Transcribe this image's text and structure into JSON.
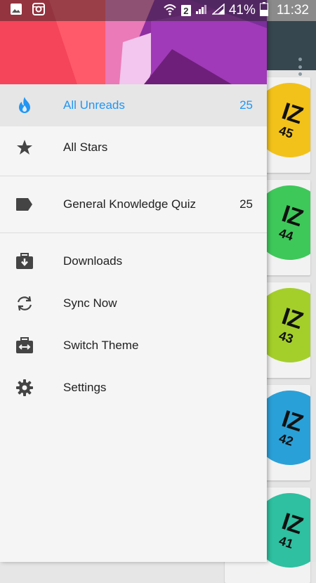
{
  "status_bar": {
    "battery_percent": "41%",
    "time": "11:32",
    "sim_slot": "2"
  },
  "nav": {
    "primary": [
      {
        "label": "All Unreads",
        "count": "25",
        "icon": "flame-icon",
        "active": true
      },
      {
        "label": "All Stars",
        "count": "",
        "icon": "star-icon",
        "active": false
      }
    ],
    "feeds": [
      {
        "label": "General Knowledge Quiz",
        "count": "25",
        "icon": "label-tag-icon"
      }
    ],
    "actions": [
      {
        "label": "Downloads",
        "icon": "download-box-icon"
      },
      {
        "label": "Sync Now",
        "icon": "sync-icon"
      },
      {
        "label": "Switch Theme",
        "icon": "switch-theme-icon"
      },
      {
        "label": "Settings",
        "icon": "gear-icon"
      }
    ]
  },
  "background": {
    "cards": [
      {
        "badge": "IZ",
        "number": "45",
        "color": "#f3c21a"
      },
      {
        "badge": "IZ",
        "number": "44",
        "color": "#3ec85a"
      },
      {
        "badge": "IZ",
        "number": "43",
        "color": "#a4cf2a"
      },
      {
        "badge": "IZ",
        "number": "42",
        "color": "#2aa0d8"
      },
      {
        "badge": "IZ",
        "number": "41",
        "color": "#2ec0a0"
      }
    ]
  },
  "colors": {
    "accent": "#2196f3",
    "toolbar": "#37474f"
  }
}
